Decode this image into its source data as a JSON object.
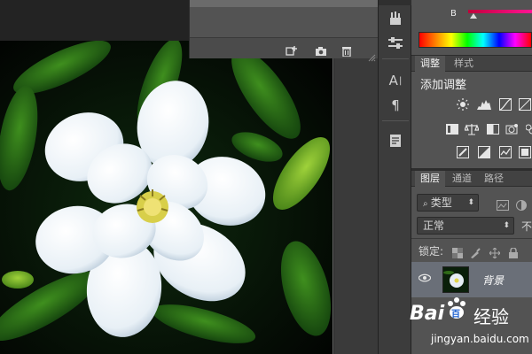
{
  "color_panel": {
    "channel_label": "B"
  },
  "floating_panel": {
    "footer_icons": [
      "new-snapshot-icon",
      "camera-icon",
      "trash-icon"
    ]
  },
  "tool_column": {
    "icons": [
      "brush-settings-icon",
      "adjust-sliders-icon",
      "character-icon",
      "paragraph-icon",
      "notes-icon"
    ],
    "character_glyph": "A",
    "paragraph_glyph": "¶"
  },
  "adjustments_panel": {
    "tabs": [
      "调整",
      "样式"
    ],
    "active_tab": "调整",
    "title": "添加调整"
  },
  "layers_panel": {
    "tabs": [
      "图层",
      "通道",
      "路径"
    ],
    "active_tab": "图层",
    "filter_kind": "类型",
    "blend_mode": "正常",
    "opacity_label_partial": "不",
    "lock_label": "锁定:",
    "layers": [
      {
        "name": "背景",
        "visible": true
      }
    ]
  },
  "watermark": {
    "logo_text": "Bai",
    "logo_suffix": "百",
    "brand_cn": "经验",
    "url": "jingyan.baidu.com"
  },
  "colors": {
    "panel": "#535353",
    "panel_dark": "#3c3c3c",
    "selected_layer": "#6a6f78",
    "spectrum_accent": "#e0003c"
  }
}
